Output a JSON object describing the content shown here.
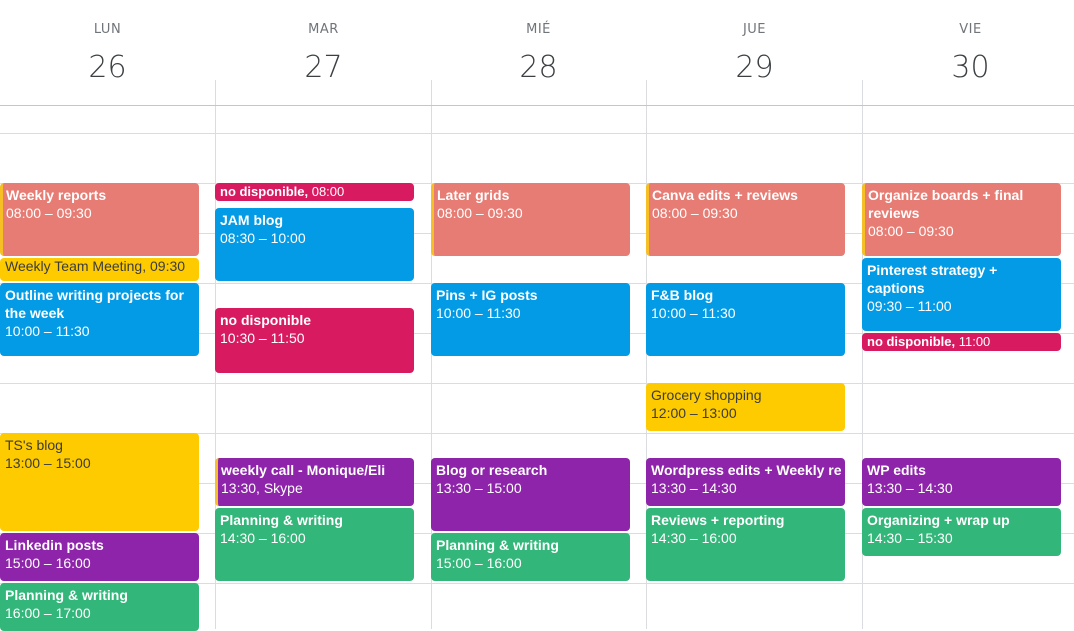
{
  "colors": {
    "flamingo": "#e67c73",
    "peacock": "#039be5",
    "banana": "#f6bf26",
    "yellow": "#fdcb00",
    "cherry": "#d81b60",
    "grape": "#8e24aa",
    "basil": "#33b679"
  },
  "days": [
    {
      "name": "LUN",
      "num": "26"
    },
    {
      "name": "MAR",
      "num": "27"
    },
    {
      "name": "MIÉ",
      "num": "28"
    },
    {
      "name": "JUE",
      "num": "29"
    },
    {
      "name": "VIE",
      "num": "30"
    }
  ],
  "events": [
    {
      "day": 0,
      "title": "Weekly reports",
      "time": "08:00 – 09:30",
      "start": 8.0,
      "end": 9.5,
      "color": "flamingo",
      "stripe": true
    },
    {
      "day": 0,
      "title": "Weekly Team Meeting",
      "time": "09:30",
      "start": 9.5,
      "end": 10.0,
      "color": "yellow",
      "single": true,
      "dark": true
    },
    {
      "day": 0,
      "title": "Outline writing projects for the week",
      "time": "10:00 – 11:30",
      "start": 10.0,
      "end": 11.5,
      "color": "peacock"
    },
    {
      "day": 0,
      "title": "TS's blog",
      "time": "13:00 – 15:00",
      "start": 13.0,
      "end": 15.0,
      "color": "yellow",
      "dark": true
    },
    {
      "day": 0,
      "title": "Linkedin posts",
      "time": "15:00 – 16:00",
      "start": 15.0,
      "end": 16.0,
      "color": "grape"
    },
    {
      "day": 0,
      "title": "Planning & writing",
      "time": "16:00 – 17:00",
      "start": 16.0,
      "end": 17.0,
      "color": "basil"
    },
    {
      "day": 1,
      "title": "no disponible",
      "time": "08:00",
      "start": 8.0,
      "end": 8.4,
      "color": "cherry",
      "single": true
    },
    {
      "day": 1,
      "title": "JAM blog",
      "time": "08:30 – 10:00",
      "start": 8.5,
      "end": 10.0,
      "color": "peacock"
    },
    {
      "day": 1,
      "title": "no disponible",
      "time": "10:30 – 11:50",
      "start": 10.5,
      "end": 11.8333,
      "color": "cherry"
    },
    {
      "day": 1,
      "title": "weekly call - Monique/Eli",
      "time": "13:30, Skype",
      "start": 13.5,
      "end": 14.5,
      "color": "grape",
      "stripe": true
    },
    {
      "day": 1,
      "title": "Planning & writing",
      "time": "14:30 – 16:00",
      "start": 14.5,
      "end": 16.0,
      "color": "basil"
    },
    {
      "day": 2,
      "title": "Later grids",
      "time": "08:00 – 09:30",
      "start": 8.0,
      "end": 9.5,
      "color": "flamingo",
      "stripe": true
    },
    {
      "day": 2,
      "title": "Pins + IG posts",
      "time": "10:00 – 11:30",
      "start": 10.0,
      "end": 11.5,
      "color": "peacock"
    },
    {
      "day": 2,
      "title": "Blog or research",
      "time": "13:30 – 15:00",
      "start": 13.5,
      "end": 15.0,
      "color": "grape"
    },
    {
      "day": 2,
      "title": "Planning & writing",
      "time": "15:00 – 16:00",
      "start": 15.0,
      "end": 16.0,
      "color": "basil"
    },
    {
      "day": 3,
      "title": "Canva edits + reviews",
      "time": "08:00 – 09:30",
      "start": 8.0,
      "end": 9.5,
      "color": "flamingo",
      "stripe": true
    },
    {
      "day": 3,
      "title": "F&B blog",
      "time": "10:00 – 11:30",
      "start": 10.0,
      "end": 11.5,
      "color": "peacock"
    },
    {
      "day": 3,
      "title": "Grocery shopping",
      "time": "12:00 – 13:00",
      "start": 12.0,
      "end": 13.0,
      "color": "yellow",
      "dark": true
    },
    {
      "day": 3,
      "title": "Wordpress edits + Weekly re",
      "time": "13:30 – 14:30",
      "start": 13.5,
      "end": 14.5,
      "color": "grape",
      "nowrap": true
    },
    {
      "day": 3,
      "title": "Reviews + reporting",
      "time": "14:30 – 16:00",
      "start": 14.5,
      "end": 16.0,
      "color": "basil"
    },
    {
      "day": 4,
      "title": "Organize boards + final reviews",
      "time": "08:00 – 09:30",
      "start": 8.0,
      "end": 9.5,
      "color": "flamingo",
      "stripe": true
    },
    {
      "day": 4,
      "title": "Pinterest strategy + captions",
      "time": "09:30 – 11:00",
      "start": 9.5,
      "end": 11.0,
      "color": "peacock"
    },
    {
      "day": 4,
      "title": "no disponible",
      "time": "11:00",
      "start": 11.0,
      "end": 11.4,
      "color": "cherry",
      "single": true
    },
    {
      "day": 4,
      "title": "WP edits",
      "time": "13:30 – 14:30",
      "start": 13.5,
      "end": 14.5,
      "color": "grape"
    },
    {
      "day": 4,
      "title": "Organizing + wrap up",
      "time": "14:30 – 15:30",
      "start": 14.5,
      "end": 15.5,
      "color": "basil"
    }
  ]
}
